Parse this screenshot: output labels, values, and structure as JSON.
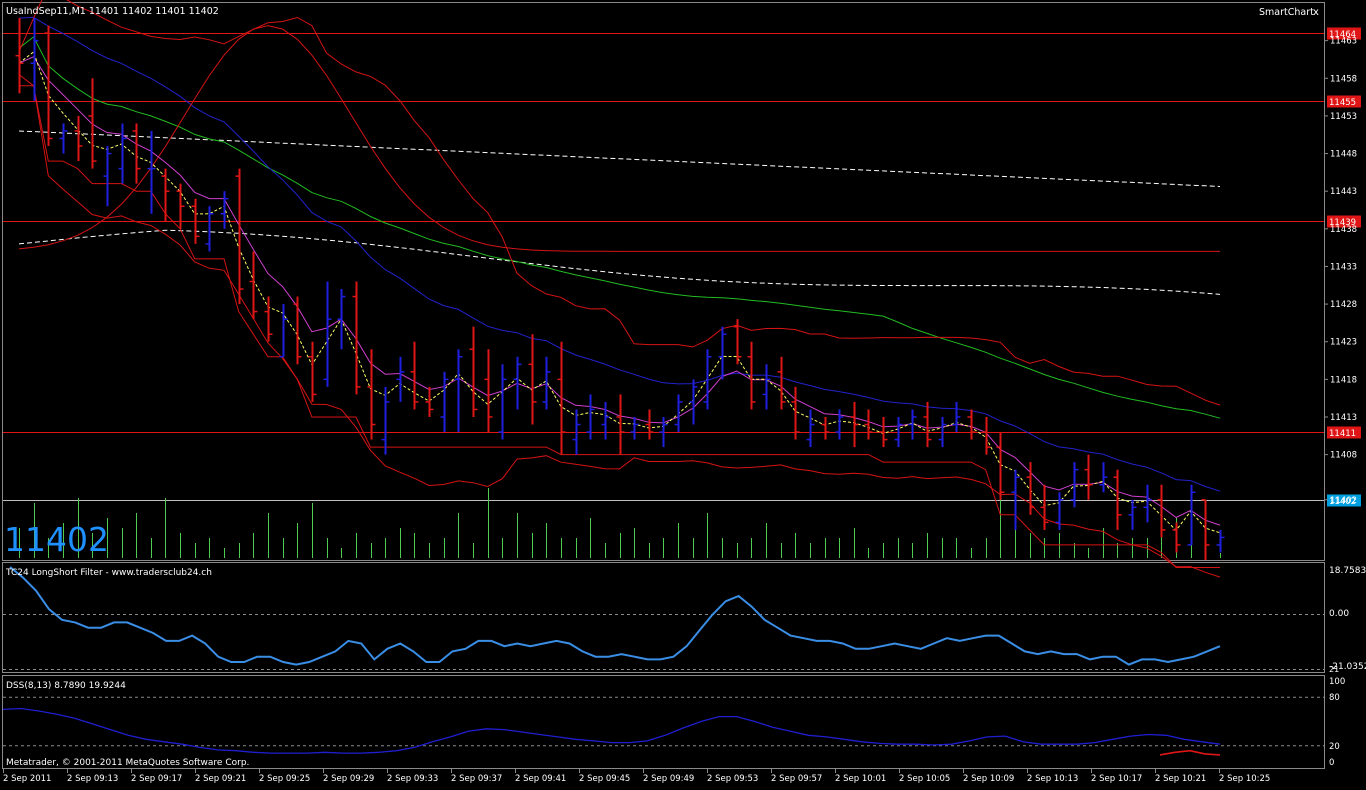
{
  "header": {
    "symbol_line": "UsaIndSep11,M1  11401 11402 11401 11402",
    "smartchart_label": "SmartChart",
    "close_glyph": "x"
  },
  "main_panel": {
    "big_price": "11402",
    "price_ticks": [
      "11463",
      "11458",
      "11453",
      "11448",
      "11443",
      "11438",
      "11433",
      "11428",
      "11423",
      "11418",
      "11413",
      "11408",
      "11402"
    ],
    "hlines": [
      {
        "label": "11464",
        "value": 11464
      },
      {
        "label": "11455",
        "value": 11455
      },
      {
        "label": "11439",
        "value": 11439
      },
      {
        "label": "11411",
        "value": 11411
      }
    ],
    "current_price_label": "11402",
    "current_price": 11402,
    "ylim": [
      11394,
      11468
    ]
  },
  "tc_panel": {
    "title": "TC24 LongShort Filter - www.tradersclub24.ch",
    "top_label": "18.7583",
    "mid_label": "0.00",
    "bottom_label": "-21.0352",
    "bottom_label2": "21",
    "ylim": [
      -21.0352,
      18.7583
    ],
    "series": [
      18,
      14,
      9,
      2,
      -2,
      -3,
      -5,
      -5,
      -3,
      -3,
      -5,
      -7,
      -10,
      -10,
      -8,
      -11,
      -16,
      -18,
      -18,
      -16,
      -16,
      -18,
      -19,
      -18,
      -16,
      -14,
      -10,
      -11,
      -17,
      -13,
      -11,
      -14,
      -18,
      -18,
      -14,
      -13,
      -10,
      -10,
      -12,
      -11,
      -12,
      -11,
      -10,
      -11,
      -14,
      -16,
      -16,
      -15,
      -16,
      -17,
      -17,
      -16,
      -12,
      -6,
      0,
      5,
      7,
      3,
      -2,
      -5,
      -8,
      -9,
      -10,
      -10,
      -11,
      -13,
      -13,
      -12,
      -11,
      -12,
      -13,
      -11,
      -9,
      -10,
      -9,
      -8,
      -8,
      -11,
      -14,
      -15,
      -14,
      -15,
      -15,
      -17,
      -16,
      -16,
      -19,
      -17,
      -17,
      -18,
      -17,
      -16,
      -14,
      -12
    ],
    "color": "#3a8ee6"
  },
  "dss_panel": {
    "title": "DSS(8,13) 8.7890 19.9244",
    "ticks": [
      "100",
      "80",
      "20",
      "0"
    ],
    "levels": [
      80,
      20
    ],
    "ylim": [
      0,
      100
    ],
    "signal": [
      65,
      66,
      63,
      59,
      54,
      47,
      40,
      33,
      28,
      25,
      22,
      18,
      15,
      14,
      12,
      11,
      11,
      11,
      12,
      11,
      11,
      12,
      14,
      18,
      25,
      31,
      38,
      41,
      40,
      37,
      34,
      31,
      28,
      26,
      24,
      24,
      26,
      33,
      42,
      50,
      56,
      56,
      50,
      43,
      38,
      33,
      31,
      28,
      25,
      23,
      22,
      22,
      21,
      22,
      26,
      31,
      32,
      25,
      22,
      22,
      22,
      24,
      28,
      32,
      34,
      33,
      28,
      25,
      22
    ],
    "main": [
      8.789,
      12,
      14,
      10,
      8.789
    ],
    "main_x_start": 0.935,
    "signal_color": "#1f1fd0",
    "main_color": "#e01616"
  },
  "time_axis": {
    "labels": [
      "2 Sep 2011",
      "2 Sep 09:13",
      "2 Sep 09:17",
      "2 Sep 09:21",
      "2 Sep 09:25",
      "2 Sep 09:29",
      "2 Sep 09:33",
      "2 Sep 09:37",
      "2 Sep 09:41",
      "2 Sep 09:45",
      "2 Sep 09:49",
      "2 Sep 09:53",
      "2 Sep 09:57",
      "2 Sep 10:01",
      "2 Sep 10:05",
      "2 Sep 10:09",
      "2 Sep 10:13",
      "2 Sep 10:17",
      "2 Sep 10:21",
      "2 Sep 10:25"
    ]
  },
  "copyright": "Metatrader, © 2001-2011 MetaQuotes Software Corp.",
  "colors": {
    "grid": "#8a8a8a",
    "text": "#ffffff",
    "hline": "#e01616",
    "price_box": "#00a0e0",
    "up_bar": "#1f1fe0",
    "down_bar": "#e01616",
    "volume": "#4fcc4f",
    "bb": "#d51414",
    "sma_blue": "#2222cc",
    "sma_green": "#22bb22",
    "magenta": "#d040d0",
    "yellow": "#ffff66",
    "dashed_white": "#ffffff"
  },
  "chart_data": {
    "type": "candlestick",
    "title": "UsaIndSep11,M1",
    "ylim": [
      11394,
      11468
    ],
    "bars": [
      [
        11461,
        11466,
        11456,
        11460
      ],
      [
        11460,
        11466,
        11455,
        11463
      ],
      [
        11464,
        11465,
        11449,
        11450
      ],
      [
        11450,
        11452,
        11448,
        11451
      ],
      [
        11451,
        11453,
        11447,
        11449
      ],
      [
        11453,
        11458,
        11446,
        11447
      ],
      [
        11445,
        11449,
        11441,
        11448
      ],
      [
        11446,
        11452,
        11444,
        11450
      ],
      [
        11451,
        11452,
        11444,
        11446
      ],
      [
        11446,
        11451,
        11440,
        11446
      ],
      [
        11445,
        11446,
        11439,
        11443
      ],
      [
        11443,
        11444,
        11438,
        11441
      ],
      [
        11441,
        11442,
        11436,
        11437
      ],
      [
        11436,
        11441,
        11435,
        11440
      ],
      [
        11440,
        11443,
        11438,
        11442
      ],
      [
        11445,
        11446,
        11428,
        11430
      ],
      [
        11431,
        11435,
        11426,
        11427
      ],
      [
        11427,
        11429,
        11423,
        11424
      ],
      [
        11421,
        11428,
        11421,
        11426
      ],
      [
        11428,
        11429,
        11420,
        11421
      ],
      [
        11421,
        11423,
        11415,
        11416
      ],
      [
        11418,
        11431,
        11417,
        11426
      ],
      [
        11426,
        11430,
        11422,
        11429
      ],
      [
        11429,
        11431,
        11416,
        11417
      ],
      [
        11417,
        11422,
        11410,
        11412
      ],
      [
        11410,
        11417,
        11408,
        11415
      ],
      [
        11418,
        11421,
        11415,
        11419
      ],
      [
        11419,
        11423,
        11414,
        11415
      ],
      [
        11415,
        11417,
        11413,
        11414
      ],
      [
        11413,
        11419,
        11411,
        11418
      ],
      [
        11418,
        11422,
        11411,
        11421
      ],
      [
        11422,
        11425,
        11413,
        11414
      ],
      [
        11418,
        11422,
        11411,
        11413
      ],
      [
        11411,
        11420,
        11410,
        11418
      ],
      [
        11418,
        11421,
        11414,
        11420
      ],
      [
        11420,
        11424,
        11412,
        11415
      ],
      [
        11415,
        11421,
        11414,
        11419
      ],
      [
        11418,
        11423,
        11408,
        11411
      ],
      [
        11410,
        11414,
        11408,
        11412
      ],
      [
        11411,
        11416,
        11410,
        11414
      ],
      [
        11412,
        11415,
        11410,
        11413
      ],
      [
        11413,
        11416,
        11408,
        11411
      ],
      [
        11411,
        11413,
        11410,
        11412
      ],
      [
        11412,
        11414,
        11410,
        11411
      ],
      [
        11411,
        11413,
        11409,
        11412
      ],
      [
        11412,
        11416,
        11411,
        11415
      ],
      [
        11415,
        11418,
        11412,
        11417
      ],
      [
        11415,
        11422,
        11414,
        11421
      ],
      [
        11421,
        11425,
        11418,
        11424
      ],
      [
        11425,
        11426,
        11420,
        11421
      ],
      [
        11421,
        11423,
        11414,
        11415
      ],
      [
        11416,
        11420,
        11414,
        11418
      ],
      [
        11419,
        11421,
        11414,
        11415
      ],
      [
        11415,
        11417,
        11410,
        11411
      ],
      [
        11410,
        11414,
        11409,
        11412
      ],
      [
        11412,
        11413,
        11410,
        11411
      ],
      [
        11411,
        11414,
        11410,
        11413
      ],
      [
        11413,
        11415,
        11409,
        11412
      ],
      [
        11412,
        11414,
        11410,
        11411
      ],
      [
        11411,
        11413,
        11409,
        11410
      ],
      [
        11410,
        11413,
        11409,
        11412
      ],
      [
        11412,
        11414,
        11410,
        11413
      ],
      [
        11413,
        11415,
        11409,
        11410
      ],
      [
        11410,
        11413,
        11409,
        11412
      ],
      [
        11412,
        11415,
        11411,
        11413
      ],
      [
        11413,
        11414,
        11410,
        11411
      ],
      [
        11411,
        11413,
        11408,
        11409
      ],
      [
        11409,
        11411,
        11402,
        11403
      ],
      [
        11403,
        11406,
        11398,
        11405
      ],
      [
        11405,
        11407,
        11400,
        11401
      ],
      [
        11401,
        11404,
        11398,
        11399
      ],
      [
        11399,
        11403,
        11398,
        11402
      ],
      [
        11402,
        11407,
        11401,
        11406
      ],
      [
        11406,
        11408,
        11402,
        11404
      ],
      [
        11404,
        11407,
        11403,
        11405
      ],
      [
        11405,
        11406,
        11398,
        11400
      ],
      [
        11400,
        11402,
        11398,
        11401
      ],
      [
        11401,
        11404,
        11399,
        11402
      ],
      [
        11402,
        11404,
        11397,
        11398
      ],
      [
        11398,
        11399,
        11395,
        11396
      ],
      [
        11396,
        11404,
        11396,
        11403
      ],
      [
        11402,
        11402,
        11394,
        11396
      ],
      [
        11396,
        11398,
        11395,
        11397
      ]
    ],
    "volume": [
      30,
      55,
      20,
      35,
      60,
      25,
      40,
      30,
      45,
      20,
      60,
      25,
      15,
      20,
      10,
      15,
      25,
      45,
      20,
      35,
      55,
      20,
      10,
      25,
      15,
      20,
      30,
      25,
      15,
      20,
      45,
      15,
      70,
      20,
      45,
      25,
      35,
      20,
      20,
      40,
      15,
      25,
      30,
      15,
      20,
      35,
      20,
      45,
      20,
      15,
      20,
      35,
      15,
      25,
      15,
      20,
      20,
      30,
      10,
      15,
      20,
      15,
      25,
      20,
      20,
      10,
      20,
      60,
      30,
      25,
      20,
      25,
      15,
      10,
      30,
      15,
      20,
      20,
      25,
      40,
      15,
      20,
      5
    ]
  }
}
